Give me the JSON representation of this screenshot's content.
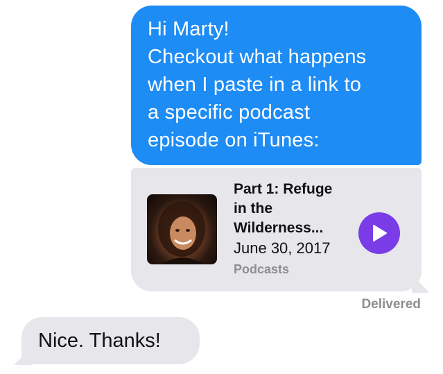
{
  "colors": {
    "outgoing_bubble": "#1e8cf5",
    "incoming_bubble": "#e6e6eb",
    "play_button": "#7a3ce6",
    "secondary_text": "#8e8e93"
  },
  "messages": {
    "outgoing": {
      "lines": [
        "Hi Marty!",
        "Checkout what happens",
        "when I paste in a link to",
        "a specific podcast",
        "episode on iTunes:"
      ]
    },
    "link_card": {
      "title_lines": [
        "Part 1: Refuge",
        "in the",
        "Wilderness..."
      ],
      "date": "June 30, 2017",
      "source": "Podcasts",
      "thumbnail_icon": "podcast-artwork",
      "play_icon": "play-icon"
    },
    "status": "Delivered",
    "incoming": {
      "text": "Nice. Thanks!"
    }
  }
}
